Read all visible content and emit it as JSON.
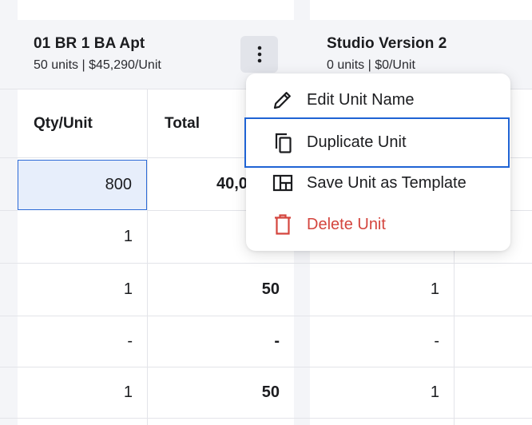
{
  "units": [
    {
      "title": "01 BR 1 BA Apt",
      "subtitle": "50 units | $45,290/Unit",
      "columns": [
        "Qty/Unit",
        "Total"
      ],
      "rows": [
        {
          "qty": "800",
          "total": "40,0"
        },
        {
          "qty": "1",
          "total": ""
        },
        {
          "qty": "1",
          "total": "50"
        },
        {
          "qty": "-",
          "total": "-"
        },
        {
          "qty": "1",
          "total": "50"
        }
      ]
    },
    {
      "title": "Studio Version 2",
      "subtitle": "0 units | $0/Unit",
      "rows": [
        {
          "qty": ""
        },
        {
          "qty": ""
        },
        {
          "qty": "1"
        },
        {
          "qty": "-"
        },
        {
          "qty": "1"
        }
      ]
    }
  ],
  "menu": {
    "items": [
      {
        "label": "Edit Unit Name",
        "icon": "pencil-icon"
      },
      {
        "label": "Duplicate Unit",
        "icon": "copy-icon"
      },
      {
        "label": "Save Unit as Template",
        "icon": "template-icon"
      },
      {
        "label": "Delete Unit",
        "icon": "trash-icon"
      }
    ]
  },
  "colors": {
    "accent": "#1f63d4",
    "danger": "#d4453e",
    "selected_cell_bg": "#e7eefb",
    "header_bg": "#f4f5f8"
  }
}
